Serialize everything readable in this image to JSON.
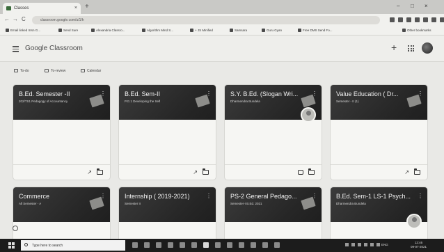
{
  "browser": {
    "tab_title": "Classes",
    "tab_close": "×",
    "new_tab": "+",
    "window_controls": [
      "–",
      "□",
      "×"
    ],
    "nav": {
      "back": "←",
      "forward": "→",
      "reload": "C"
    },
    "url": "classroom.google.com/u/1/h",
    "bookmarks": [
      "Email linked Irrsn G...",
      "Send Sure",
      "Alexandria Classro...",
      "Algorithm Mind S...",
      "+ JS Minified",
      "Samsara",
      "Guru Gyan",
      "Free DMS Send Fo..."
    ],
    "bookmarks_right": "Other bookmarks"
  },
  "app": {
    "title": "Google Classroom",
    "add_icon": "+",
    "subnav": [
      "To-do",
      "To-review",
      "Calendar"
    ]
  },
  "classes": [
    {
      "title": "B.Ed. Semester -II",
      "subtitle": "202/TS1 Pedagogy of Accountancy",
      "menu": "⋮"
    },
    {
      "title": "B.Ed. Sem-II",
      "subtitle": "P.G.1 Developing the Self",
      "menu": "⋮"
    },
    {
      "title": "S.Y. B.Ed. (Slogan Wri...",
      "subtitle": "Dharmendra Bundela",
      "menu": "⋮"
    },
    {
      "title": "Value Education ( Dr...",
      "subtitle": "Semester - II (1)",
      "menu": "⋮"
    },
    {
      "title": "Commerce",
      "subtitle": "All Semester - A",
      "menu": "⋮"
    },
    {
      "title": "Internship ( 2019-2021)",
      "subtitle": "Semester II",
      "menu": "⋮"
    },
    {
      "title": "PS-2 General Pedago...",
      "subtitle": "Semester-I B.Ed. 2021",
      "menu": "⋮"
    },
    {
      "title": "B.Ed. Sem-1 LS-1 Psych...",
      "subtitle": "Dharmendra Bundela",
      "menu": "⋮"
    }
  ],
  "taskbar": {
    "search_placeholder": "Type here to search",
    "lang": "ENG",
    "time": "12:46",
    "date": "09-07-2021"
  }
}
